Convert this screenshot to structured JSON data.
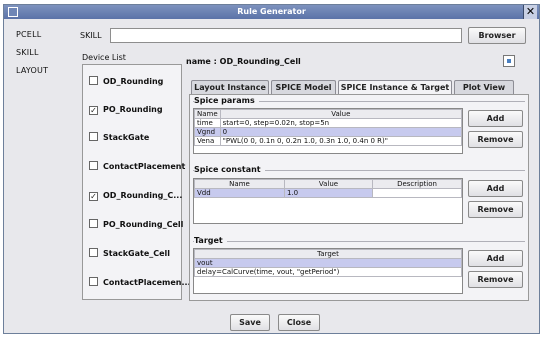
{
  "window": {
    "title": "Rule Generator"
  },
  "nav": {
    "items": [
      "PCELL",
      "SKILL",
      "LAYOUT"
    ]
  },
  "skill": {
    "label": "SKILL",
    "value": "",
    "browse_label": "Browser"
  },
  "device_list": {
    "title": "Device List",
    "items": [
      {
        "label": "OD_Rounding",
        "checked": false
      },
      {
        "label": "PO_Rounding",
        "checked": true
      },
      {
        "label": "StackGate",
        "checked": false
      },
      {
        "label": "ContactPlacement",
        "checked": false
      },
      {
        "label": "OD_Rounding_C...",
        "checked": true
      },
      {
        "label": "PO_Rounding_Cell",
        "checked": false
      },
      {
        "label": "StackGate_Cell",
        "checked": false
      },
      {
        "label": "ContactPlacemen...",
        "checked": false
      }
    ]
  },
  "name_line": {
    "prefix": "name :",
    "value": "OD_Rounding_Cell"
  },
  "tabs": [
    "Layout Instance",
    "SPICE Model",
    "SPICE Instance & Target",
    "Plot View"
  ],
  "active_tab": "SPICE Instance & Target",
  "spice_params": {
    "title": "Spice params",
    "columns": [
      "Name",
      "Value"
    ],
    "rows": [
      {
        "name": "time",
        "value": "start=0, step=0.02n, stop=5n"
      },
      {
        "name": "Vgnd",
        "value": "0"
      },
      {
        "name": "Vena",
        "value": "\"PWL(0 0, 0.1n 0, 0.2n 1.0, 0.3n 1.0, 0.4n 0 R)\""
      }
    ],
    "add_label": "Add",
    "remove_label": "Remove"
  },
  "spice_constant": {
    "title": "Spice constant",
    "columns": [
      "Name",
      "Value",
      "Description"
    ],
    "rows": [
      {
        "name": "Vdd",
        "value": "1.0",
        "description": ""
      }
    ],
    "add_label": "Add",
    "remove_label": "Remove"
  },
  "target": {
    "title": "Target",
    "columns": [
      "Target"
    ],
    "rows": [
      "vout",
      "delay=CalCurve(time, vout, \"getPeriod\")"
    ],
    "add_label": "Add",
    "remove_label": "Remove"
  },
  "footer": {
    "save_label": "Save",
    "close_label": "Close"
  },
  "colors": {
    "titlebar": "#5b73a8",
    "selection": "#c7caee",
    "panel": "#f3f3f6"
  }
}
